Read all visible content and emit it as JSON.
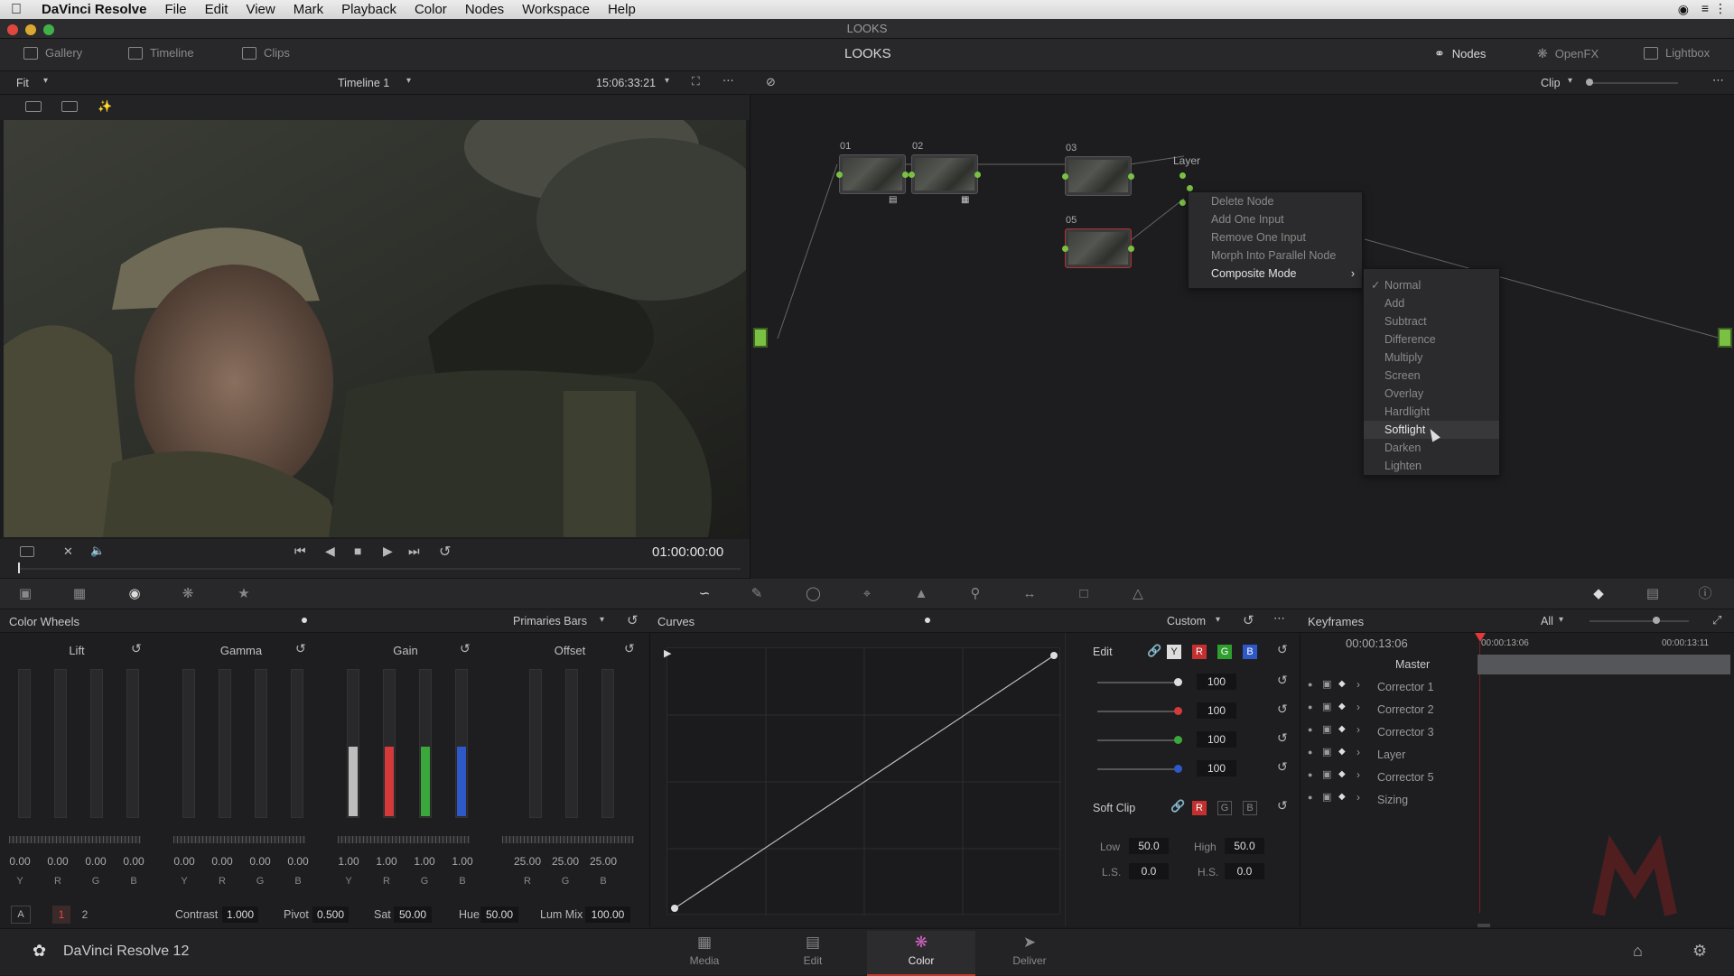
{
  "menubar": {
    "app": "DaVinci Resolve",
    "items": [
      "File",
      "Edit",
      "View",
      "Mark",
      "Playback",
      "Color",
      "Nodes",
      "Workspace",
      "Help"
    ]
  },
  "window": {
    "title": "LOOKS"
  },
  "topbar": {
    "gallery": "Gallery",
    "timeline": "Timeline",
    "clips": "Clips",
    "page_title": "LOOKS",
    "nodes": "Nodes",
    "openfx": "OpenFX",
    "lightbox": "Lightbox"
  },
  "viewbar": {
    "zoom": "Fit",
    "timeline_name": "Timeline 1",
    "timecode": "15:06:33:21"
  },
  "transport": {
    "timecode": "01:00:00:00"
  },
  "nodebar": {
    "mode": "Clip"
  },
  "nodes": {
    "n1": "01",
    "n2": "02",
    "n3": "03",
    "n5": "05",
    "layer": "Layer"
  },
  "context_menu": {
    "items": [
      "Delete Node",
      "Add One Input",
      "Remove One Input",
      "Morph Into Parallel Node",
      "Composite Mode"
    ]
  },
  "composite_submenu": {
    "items": [
      "Normal",
      "Add",
      "Subtract",
      "Difference",
      "Multiply",
      "Screen",
      "Overlay",
      "Hardlight",
      "Softlight",
      "Darken",
      "Lighten"
    ],
    "checked": "Normal",
    "highlighted": "Softlight"
  },
  "color_wheels": {
    "title": "Color Wheels",
    "mode": "Primaries Bars",
    "lift": {
      "label": "Lift",
      "values": [
        "0.00",
        "0.00",
        "0.00",
        "0.00"
      ],
      "channels": [
        "Y",
        "R",
        "G",
        "B"
      ]
    },
    "gamma": {
      "label": "Gamma",
      "values": [
        "0.00",
        "0.00",
        "0.00",
        "0.00"
      ],
      "channels": [
        "Y",
        "R",
        "G",
        "B"
      ]
    },
    "gain": {
      "label": "Gain",
      "values": [
        "1.00",
        "1.00",
        "1.00",
        "1.00"
      ],
      "channels": [
        "Y",
        "R",
        "G",
        "B"
      ]
    },
    "offset": {
      "label": "Offset",
      "values": [
        "25.00",
        "25.00",
        "25.00"
      ],
      "channels": [
        "R",
        "G",
        "B"
      ]
    },
    "footer": {
      "a": "A",
      "p1": "1",
      "p2": "2",
      "contrast_label": "Contrast",
      "contrast": "1.000",
      "pivot_label": "Pivot",
      "pivot": "0.500",
      "sat_label": "Sat",
      "sat": "50.00",
      "hue_label": "Hue",
      "hue": "50.00",
      "lummix_label": "Lum Mix",
      "lummix": "100.00"
    }
  },
  "curves": {
    "title": "Curves",
    "mode": "Custom"
  },
  "edit": {
    "label": "Edit",
    "y": "Y",
    "r": "R",
    "g": "G",
    "b": "B",
    "values": [
      "100",
      "100",
      "100",
      "100"
    ],
    "softclip_label": "Soft Clip",
    "sc_r": "R",
    "sc_g": "G",
    "sc_b": "B",
    "low_label": "Low",
    "low": "50.0",
    "high_label": "High",
    "high": "50.0",
    "ls_label": "L.S.",
    "ls": "0.0",
    "hs_label": "H.S.",
    "hs": "0.0"
  },
  "keyframes": {
    "title": "Keyframes",
    "filter": "All",
    "time_current": "00:00:13:06",
    "time_start": "00:00:13:06",
    "time_end": "00:00:13:11",
    "tracks": [
      "Master",
      "Corrector 1",
      "Corrector 2",
      "Corrector 3",
      "Layer",
      "Corrector 5",
      "Sizing"
    ]
  },
  "bottom": {
    "app_label": "DaVinci Resolve 12",
    "tabs": [
      "Media",
      "Edit",
      "Color",
      "Deliver"
    ],
    "active_tab": "Color"
  },
  "colors": {
    "accent_red": "#e23a3a",
    "node_green": "#7ac143",
    "active_tab": "#c0392b"
  }
}
